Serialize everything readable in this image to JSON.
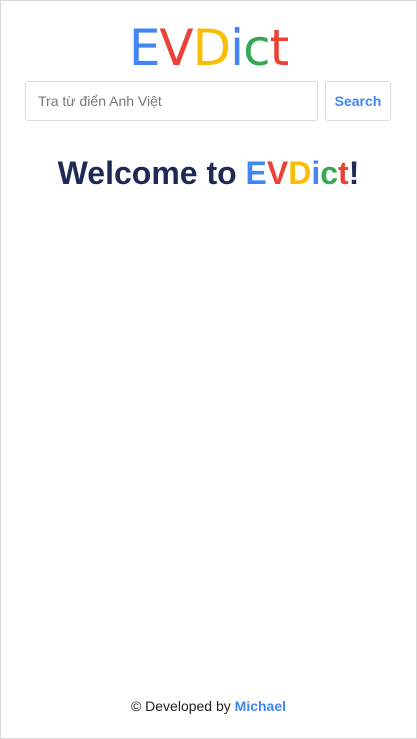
{
  "header": {
    "logo": [
      {
        "char": "E",
        "color": "#4285f4"
      },
      {
        "char": "V",
        "color": "#ea4335"
      },
      {
        "char": "D",
        "color": "#fbbc05"
      },
      {
        "char": "i",
        "color": "#4285f4"
      },
      {
        "char": "c",
        "color": "#34a853"
      },
      {
        "char": "t",
        "color": "#ea4335"
      }
    ]
  },
  "search": {
    "placeholder": "Tra từ điển Anh Việt",
    "value": "",
    "button_label": "Search"
  },
  "welcome": {
    "prefix": "Welcome to ",
    "brand": [
      {
        "char": "E",
        "color": "#4285f4"
      },
      {
        "char": "V",
        "color": "#ea4335"
      },
      {
        "char": "D",
        "color": "#fbbc05"
      },
      {
        "char": "i",
        "color": "#4285f4"
      },
      {
        "char": "c",
        "color": "#34a853"
      },
      {
        "char": "t",
        "color": "#ea4335"
      }
    ],
    "suffix": "!"
  },
  "footer": {
    "prefix": "© Developed by ",
    "author": "Michael",
    "author_color": "#4285f4"
  }
}
